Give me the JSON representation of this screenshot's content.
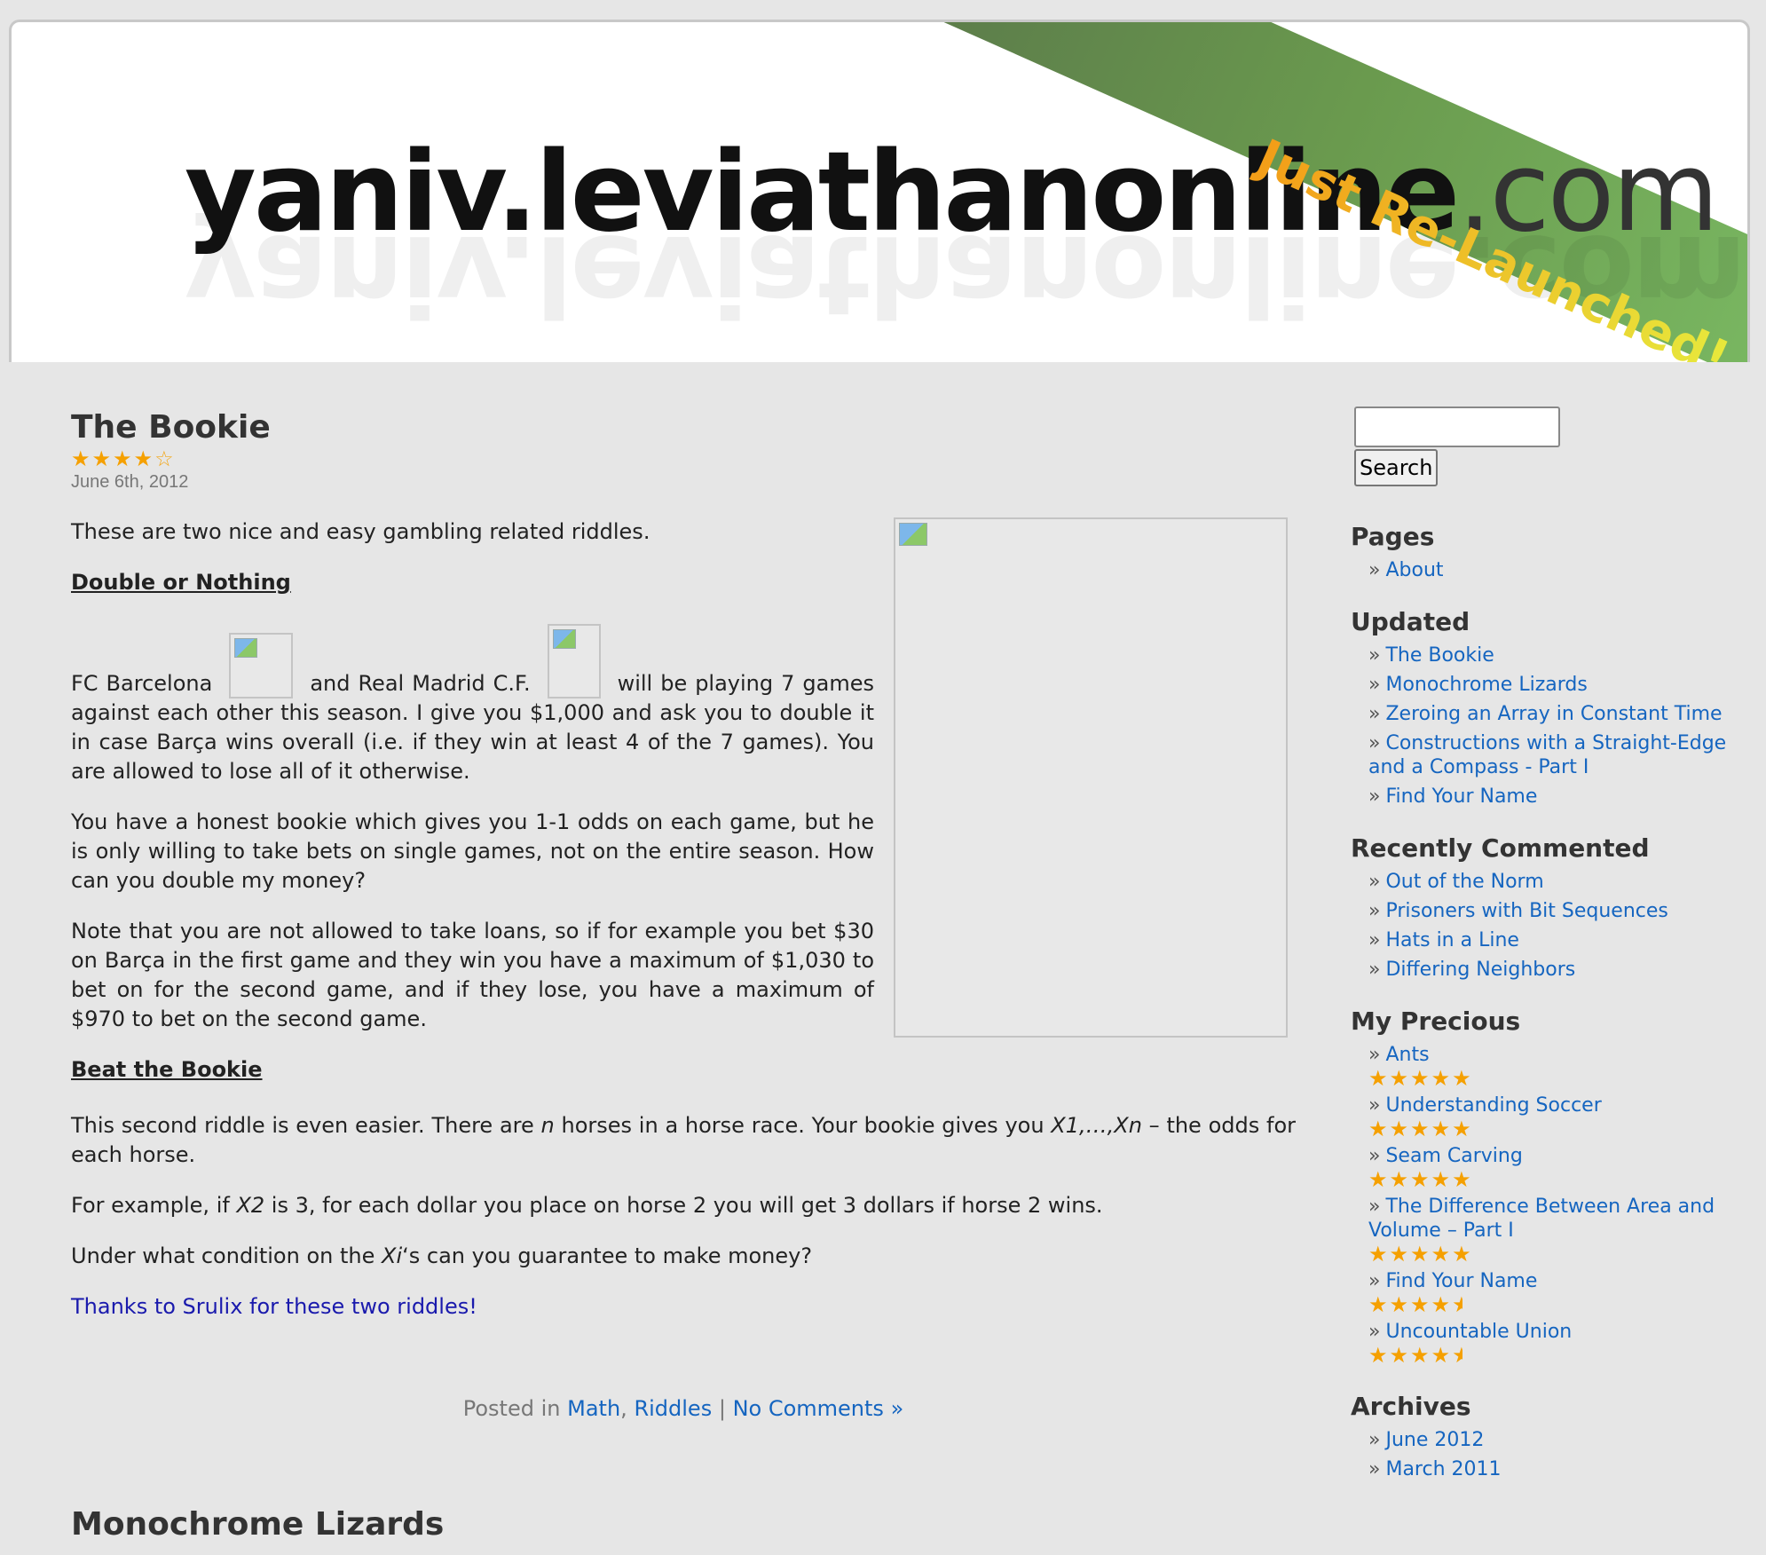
{
  "header": {
    "site_name": "yaniv.leviathanonline",
    "site_tld": ".com",
    "banner": "Just Re-Launched!"
  },
  "post": {
    "title": "The Bookie",
    "rating_stars": 4,
    "date": "June 6th, 2012",
    "intro": "These are two nice and easy gambling related riddles.",
    "h1": "Double or Nothing",
    "p1_a": "FC Barcelona",
    "p1_b": "and Real Madrid C.F.",
    "p1_c": "will be playing 7 games against each other this season. I give you $1,000 and ask you to double it in case Barça wins overall (i.e. if they win at least 4 of the 7 games). You are allowed to lose all of it otherwise.",
    "p2": "You have a honest bookie which gives you 1-1 odds on each game, but he is only willing to take bets on single games, not on the entire season. How can you double my money?",
    "p3": "Note that you are not allowed to take loans, so if for example you bet $30 on Barça in the first game and they win you have a maximum of $1,030 to bet on for the second game, and if they lose, you have a maximum of $970 to bet on the second game.",
    "h2": "Beat the Bookie",
    "p4_a": "This second riddle is even easier. There are ",
    "p4_n": "n",
    "p4_b": " horses in a horse race. Your bookie gives you ",
    "p4_x": "X1,…,Xn",
    "p4_c": " – the odds for each horse.",
    "p5_a": "For example, if ",
    "p5_x": "X2",
    "p5_b": " is 3, for each dollar you place on horse 2 you will get 3 dollars if horse 2 wins.",
    "p6_a": "Under what condition on the ",
    "p6_x": "Xi",
    "p6_b": "‘s can you guarantee to make money?",
    "thanks": "Thanks to Srulix for these two riddles!",
    "meta_posted_in": "Posted in",
    "meta_cat1": "Math",
    "meta_comma": ",",
    "meta_cat2": "Riddles",
    "meta_sep": "|",
    "meta_comments": "No Comments »",
    "next_title": "Monochrome Lizards"
  },
  "sidebar": {
    "search_button": "Search",
    "search_value": "",
    "pages_heading": "Pages",
    "pages": [
      "About"
    ],
    "updated_heading": "Updated",
    "updated": [
      "The Bookie",
      "Monochrome Lizards",
      "Zeroing an Array in Constant Time",
      "Constructions with a Straight-Edge and a Compass - Part I",
      "Find Your Name"
    ],
    "recent_heading": "Recently Commented",
    "recent": [
      "Out of the Norm",
      "Prisoners with Bit Sequences",
      "Hats in a Line",
      "Differing Neighbors"
    ],
    "precious_heading": "My Precious",
    "precious": [
      {
        "label": "Ants",
        "rating": 5
      },
      {
        "label": "Understanding Soccer",
        "rating": 5
      },
      {
        "label": "Seam Carving",
        "rating": 5
      },
      {
        "label": "The Difference Between Area and Volume – Part I",
        "rating": 5
      },
      {
        "label": "Find Your Name",
        "rating": 4.5
      },
      {
        "label": "Uncountable Union",
        "rating": 4.5
      }
    ],
    "archives_heading": "Archives",
    "archives": [
      "June 2012",
      "March 2011"
    ]
  },
  "colors": {
    "accent_link": "#1565c0",
    "thanks_link": "#1a1aad",
    "star": "#f5a000",
    "banner_green": "#6a9a4e"
  }
}
